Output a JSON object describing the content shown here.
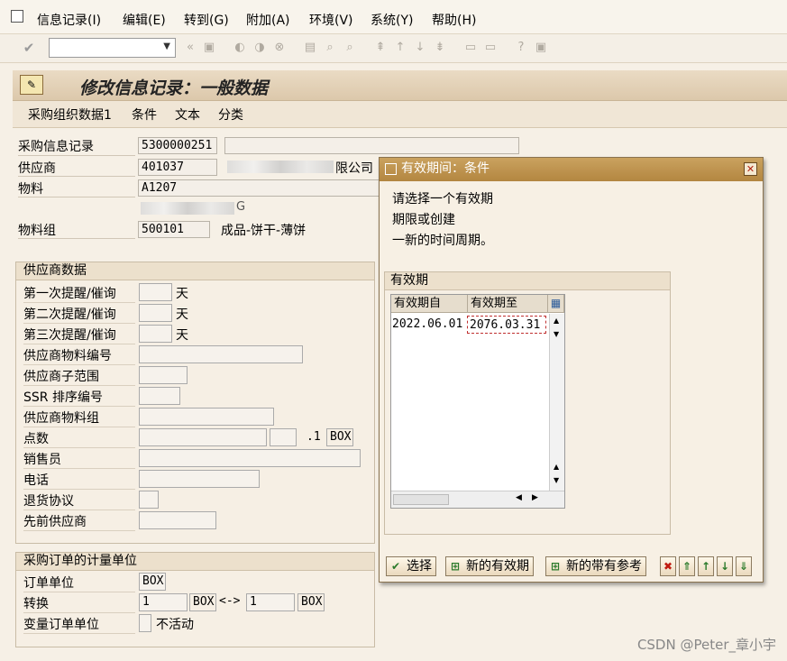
{
  "menubar": {
    "items": [
      "信息记录(I)",
      "编辑(E)",
      "转到(G)",
      "附加(A)",
      "环境(V)",
      "系统(Y)",
      "帮助(H)"
    ]
  },
  "toolbar": {
    "command_value": ""
  },
  "header": {
    "title": "修改信息记录：一般数据",
    "tabs": [
      "采购组织数据1",
      "条件",
      "文本",
      "分类"
    ]
  },
  "fields": {
    "info_record_label": "采购信息记录",
    "info_record_value": "5300000251",
    "vendor_label": "供应商",
    "vendor_value": "401037",
    "vendor_name_suffix": "限公司",
    "material_label": "物料",
    "material_value": "A1207",
    "material_desc_suffix": "G",
    "material_group_label": "物料组",
    "material_group_value": "500101",
    "material_group_desc": "成品-饼干-薄饼"
  },
  "vendor_data": {
    "title": "供应商数据",
    "rows": [
      {
        "label": "第一次提醒/催询",
        "unit": "天"
      },
      {
        "label": "第二次提醒/催询",
        "unit": "天"
      },
      {
        "label": "第三次提醒/催询",
        "unit": "天"
      },
      {
        "label": "供应商物料编号"
      },
      {
        "label": "供应商子范围"
      },
      {
        "label": "SSR 排序编号"
      },
      {
        "label": "供应商物料组"
      },
      {
        "label": "点数",
        "extra": ".1",
        "unit": "BOX"
      },
      {
        "label": "销售员"
      },
      {
        "label": "电话"
      },
      {
        "label": "退货协议"
      },
      {
        "label": "先前供应商"
      }
    ]
  },
  "po_unit": {
    "title": "采购订单的计量单位",
    "order_unit_label": "订单单位",
    "order_unit_value": "BOX",
    "conversion_label": "转换",
    "conv_left_value": "1",
    "conv_left_unit": "BOX",
    "conv_arrow": "<->",
    "conv_right_value": "1",
    "conv_right_unit": "BOX",
    "variable_label": "变量订单单位",
    "variable_status": "不活动"
  },
  "dialog": {
    "title": "有效期间：条件",
    "message": [
      "请选择一个有效期",
      "期限或创建",
      "一新的时间周期。"
    ],
    "group_title": "有效期",
    "columns": [
      "有效期自",
      "有效期至"
    ],
    "rows": [
      {
        "from": "2022.06.01",
        "to": "2076.03.31"
      }
    ],
    "buttons": {
      "select": "选择",
      "new_period": "新的有效期",
      "new_with_ref": "新的带有参考"
    }
  },
  "watermark": "CSDN @Peter_章小宇"
}
